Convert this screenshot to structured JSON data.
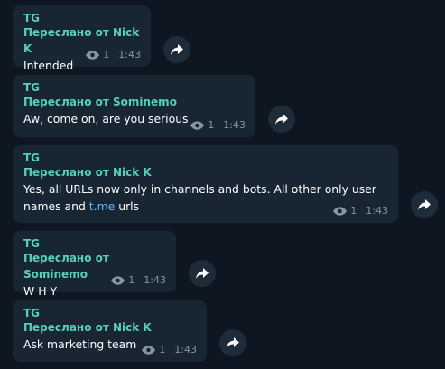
{
  "messages": [
    {
      "sender": "TG",
      "forwarded": "Переслано от Nick K",
      "text": "Intended",
      "views": "1",
      "time": "1:43"
    },
    {
      "sender": "TG",
      "forwarded": "Переслано от Sominemo",
      "text": "Aw, come on, are you serious",
      "views": "1",
      "time": "1:43"
    },
    {
      "sender": "TG",
      "forwarded": "Переслано от Nick K",
      "text_line1": "Yes, all URLs now only in channels and bots. All other only user",
      "text_line2_pre": "names and ",
      "text_link": "t.me",
      "text_line2_post": " urls",
      "views": "1",
      "time": "1:43"
    },
    {
      "sender": "TG",
      "forwarded": "Переслано от Sominemo",
      "text": "W H Y",
      "views": "1",
      "time": "1:43"
    },
    {
      "sender": "TG",
      "forwarded": "Переслано от Nick K",
      "text": "Ask marketing team",
      "views": "1",
      "time": "1:43"
    }
  ],
  "colors": {
    "background": "#0e1621",
    "bubble": "#182533",
    "accent": "#57d0b8",
    "link": "#6ab3f3",
    "meta": "#8696a4"
  },
  "icons": {
    "views": "eye-icon",
    "share": "forward-arrow-icon"
  }
}
